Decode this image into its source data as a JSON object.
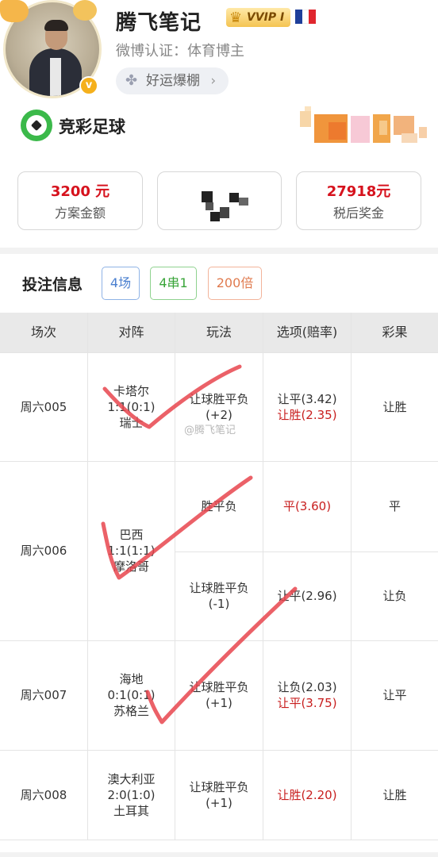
{
  "profile": {
    "name": "腾飞笔记",
    "vip_label": "VVIP I",
    "certification": "微博认证：体育博主",
    "luck_button": "好运爆棚",
    "luck_chevron": "›",
    "verified_mark": "v"
  },
  "lottery": {
    "title": "竞彩足球"
  },
  "summary": {
    "plan_amount_value": "3200 元",
    "plan_amount_label": "方案金额",
    "prize_value": "27918元",
    "prize_label": "税后奖金"
  },
  "bet": {
    "title": "投注信息",
    "tags": [
      "4场",
      "4串1",
      "200倍"
    ]
  },
  "table": {
    "headers": [
      "场次",
      "对阵",
      "玩法",
      "选项(赔率)",
      "彩果"
    ],
    "rows": [
      {
        "match_no": "周六005",
        "teams": [
          "卡塔尔",
          "1:1(0:1)",
          "瑞士"
        ],
        "plays": [
          {
            "type": [
              "让球胜平负",
              "(+2)"
            ],
            "options": [
              "让平(3.42)",
              "让胜(2.35)"
            ],
            "result": "让胜"
          }
        ]
      },
      {
        "match_no": "周六006",
        "teams": [
          "巴西",
          "1:1(1:1)",
          "摩洛哥"
        ],
        "plays": [
          {
            "type": [
              "胜平负"
            ],
            "options": [
              "平(3.60)"
            ],
            "result": "平"
          },
          {
            "type": [
              "让球胜平负",
              "(-1)"
            ],
            "options": [
              "让平(2.96)"
            ],
            "result": "让负"
          }
        ]
      },
      {
        "match_no": "周六007",
        "teams": [
          "海地",
          "0:1(0:1)",
          "苏格兰"
        ],
        "plays": [
          {
            "type": [
              "让球胜平负",
              "(+1)"
            ],
            "options": [
              "让负(2.03)",
              "让平(3.75)"
            ],
            "result": "让平"
          }
        ]
      },
      {
        "match_no": "周六008",
        "teams": [
          "澳大利亚",
          "2:0(1:0)",
          "土耳其"
        ],
        "plays": [
          {
            "type": [
              "让球胜平负",
              "(+1)"
            ],
            "options": [
              "让胜(2.20)"
            ],
            "result": "让胜"
          }
        ]
      }
    ]
  },
  "watermark": "@腾飞笔记",
  "colors": {
    "accent_red": "#c81e1e",
    "prize_red": "#d6121d",
    "check_mark": "#e8454e",
    "lottery_green": "#3bb94a"
  }
}
